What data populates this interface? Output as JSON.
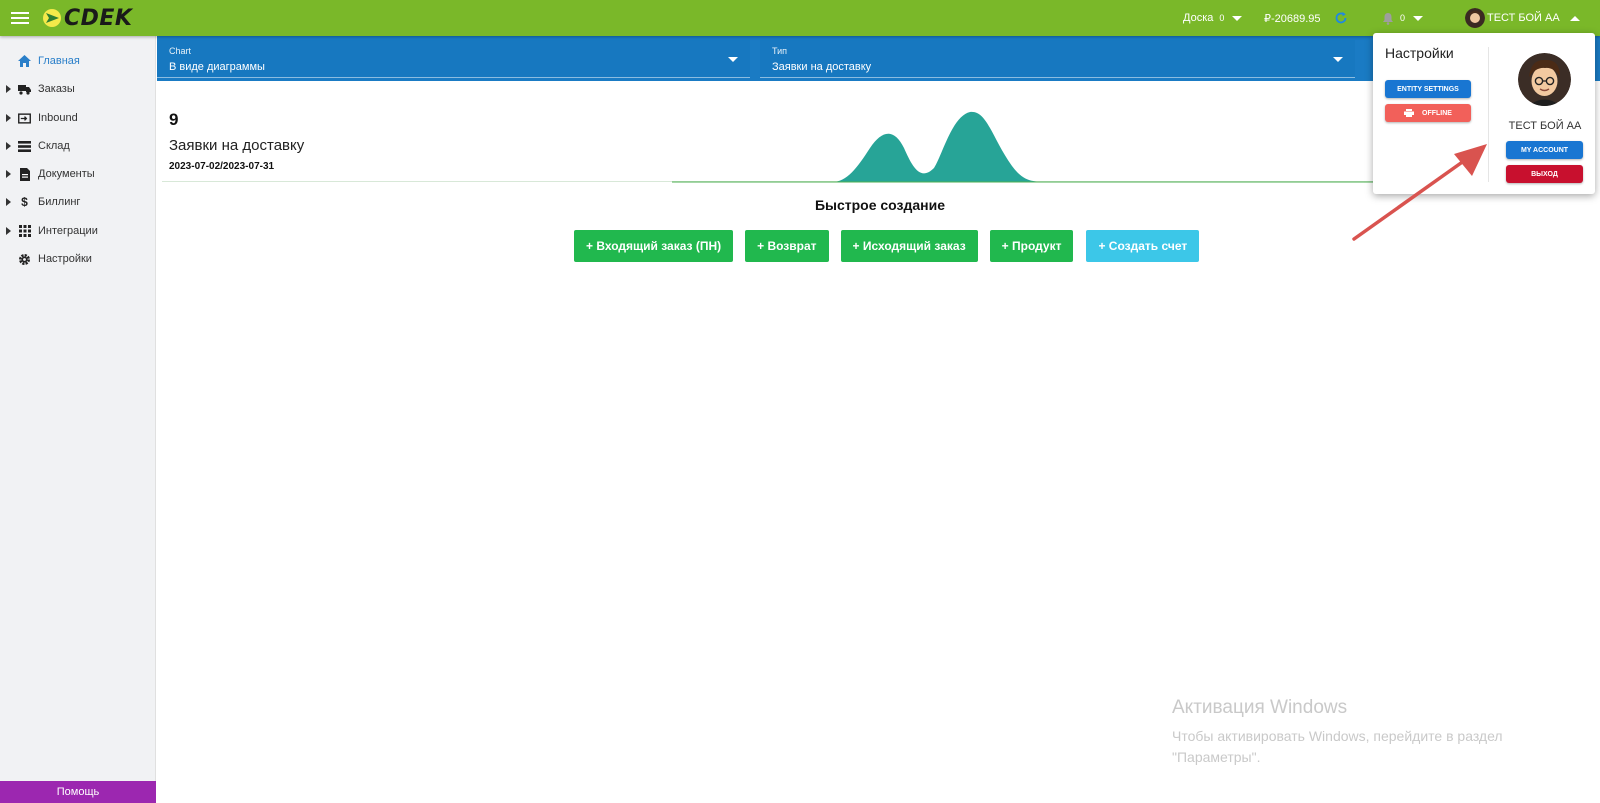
{
  "topbar": {
    "brand": "CDEK",
    "board_label": "Доска",
    "board_count": "0",
    "balance": "₽-20689.95",
    "notifications_count": "0",
    "user_name": "ТЕСТ БОЙ АА",
    "bg_color": "#7ab829"
  },
  "sidebar": {
    "items": [
      {
        "label": "Главная",
        "icon": "home-icon",
        "active": true
      },
      {
        "label": "Заказы",
        "icon": "truck-icon"
      },
      {
        "label": "Inbound",
        "icon": "inbound-icon"
      },
      {
        "label": "Склад",
        "icon": "warehouse-list-icon"
      },
      {
        "label": "Документы",
        "icon": "document-icon"
      },
      {
        "label": "Биллинг",
        "icon": "dollar-icon"
      },
      {
        "label": "Интеграции",
        "icon": "grid-icon"
      },
      {
        "label": "Настройки",
        "icon": "gear-icon"
      }
    ],
    "help_label": "Помощь",
    "help_color": "#9c27b0"
  },
  "filters": {
    "chart_label": "Chart",
    "chart_value": "В виде диаграммы",
    "type_label": "Тип",
    "type_value": "Заявки на доставку"
  },
  "stats": {
    "count": "9",
    "title": "Заявки на доставку",
    "range": "2023-07-02/2023-07-31"
  },
  "quick_create": {
    "title": "Быстрое создание",
    "buttons": [
      "+ Входящий заказ (ПН)",
      "+ Возврат",
      "+ Исходящий заказ",
      "+ Продукт",
      "+ Создать счет"
    ]
  },
  "popup": {
    "title": "Настройки",
    "entity_settings": "ENTITY SETTINGS",
    "offline": "OFFLINE",
    "user_name": "ТЕСТ БОЙ АА",
    "my_account": "MY ACCOUNT",
    "logout": "ВЫХОД"
  },
  "watermark": {
    "title": "Активация Windows",
    "text": "Чтобы активировать Windows, перейдите в раздел \"Параметры\"."
  }
}
